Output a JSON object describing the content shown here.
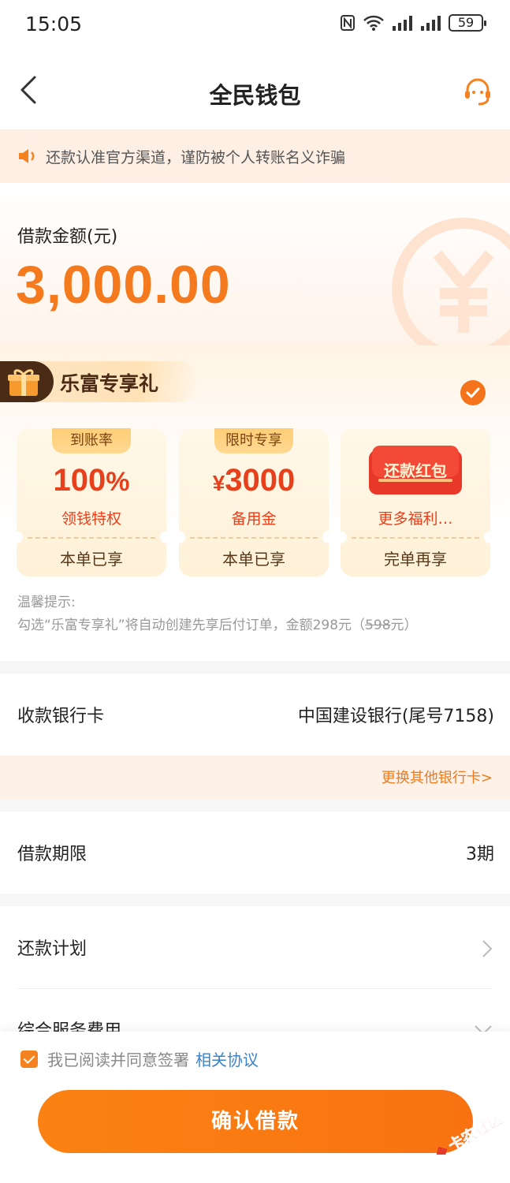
{
  "status": {
    "time": "15:05",
    "battery": "59"
  },
  "nav": {
    "title": "全民钱包"
  },
  "notice": {
    "text": "还款认准官方渠道，谨防被个人转账名义诈骗"
  },
  "amount": {
    "label": "借款金额(元)",
    "value": "3,000.00"
  },
  "gift": {
    "title": "乐富专享礼",
    "cards": [
      {
        "tab": "到账率",
        "big": "100",
        "big_suffix": "%",
        "sub": "领钱特权",
        "foot": "本单已享"
      },
      {
        "tab": "限时专享",
        "big_prefix": "¥",
        "big": "3000",
        "sub": "备用金",
        "foot": "本单已享"
      },
      {
        "banner": "还款红包",
        "sub": "更多福利…",
        "foot": "完单再享"
      }
    ],
    "tips_title": "温馨提示:",
    "tips_line_a": "勾选“乐富专享礼”将自动创建先享后付订单，金额298元（",
    "tips_strike": "598",
    "tips_line_b": "元）"
  },
  "bank": {
    "label": "收款银行卡",
    "value": "中国建设银行(尾号7158)",
    "change": "更换其他银行卡>"
  },
  "term": {
    "label": "借款期限",
    "value": "3期"
  },
  "plan": {
    "label": "还款计划"
  },
  "fee": {
    "label": "综合服务费用"
  },
  "agreement": {
    "text": "我已阅读并同意签署",
    "link": "相关协议"
  },
  "confirm": {
    "label": "确认借款"
  },
  "watermark": {
    "text": "卡农社区"
  },
  "colors": {
    "accent": "#f58220",
    "price": "#f47a1d",
    "red": "#e7401d",
    "link": "#3b83c9"
  }
}
